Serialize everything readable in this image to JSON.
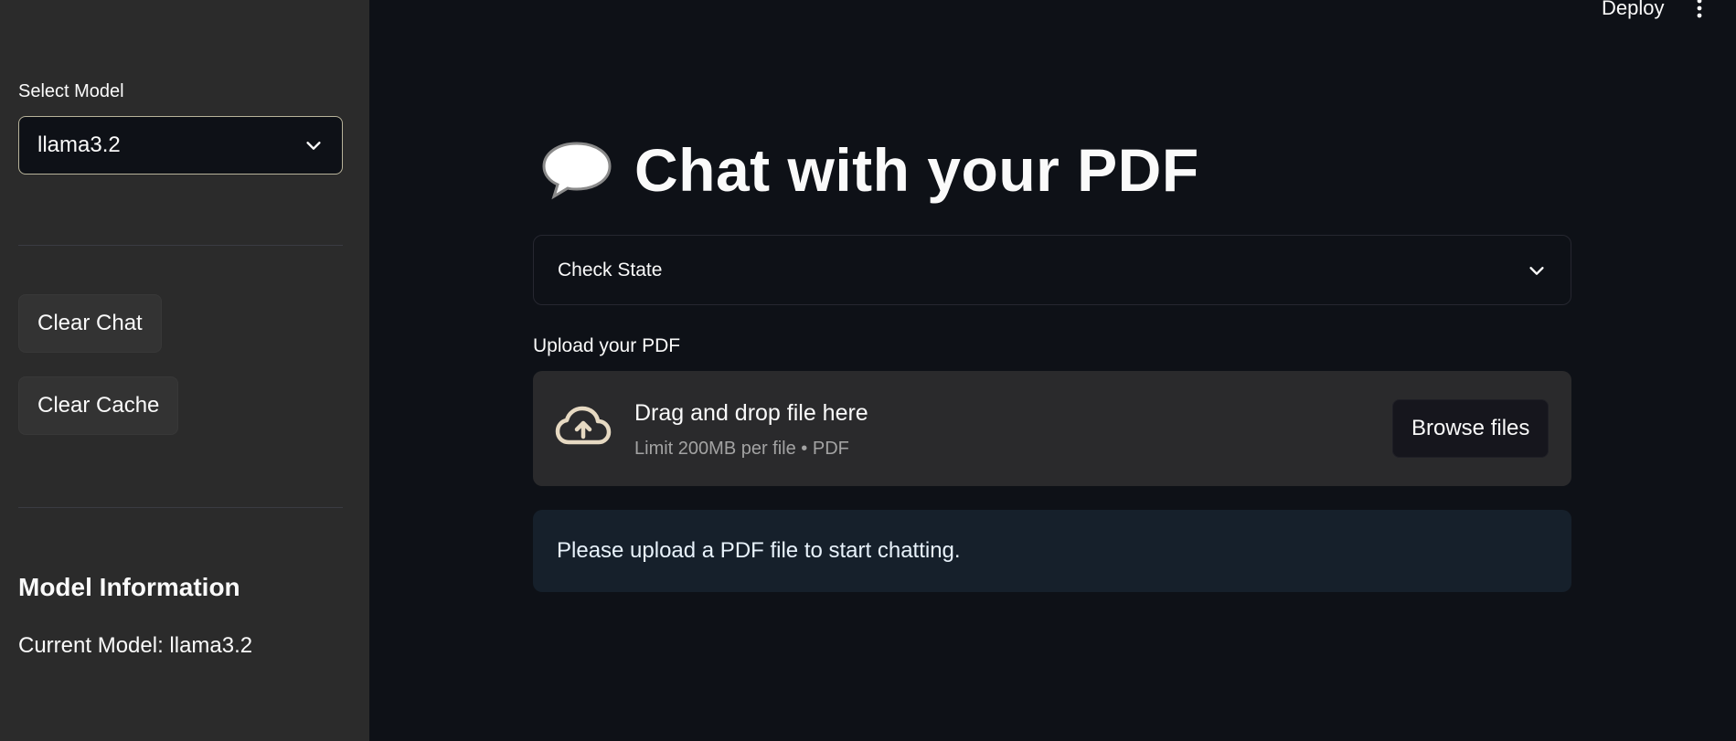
{
  "header": {
    "deploy_label": "Deploy"
  },
  "sidebar": {
    "select_label": "Select Model",
    "selected_model": "llama3.2",
    "clear_chat_label": "Clear Chat",
    "clear_cache_label": "Clear Cache",
    "info_heading": "Model Information",
    "current_model_text": "Current Model: llama3.2"
  },
  "main": {
    "title": "Chat with your PDF",
    "title_icon": "speech-balloon-icon",
    "expander_label": "Check State",
    "upload_label": "Upload your PDF",
    "dropzone_main": "Drag and drop file here",
    "dropzone_sub": "Limit 200MB per file • PDF",
    "browse_label": "Browse files",
    "info_message": "Please upload a PDF file to start chatting."
  },
  "colors": {
    "background": "#0e1117",
    "sidebar": "#2b2b2b",
    "info_bg": "#16202b",
    "text": "#fafafa"
  }
}
